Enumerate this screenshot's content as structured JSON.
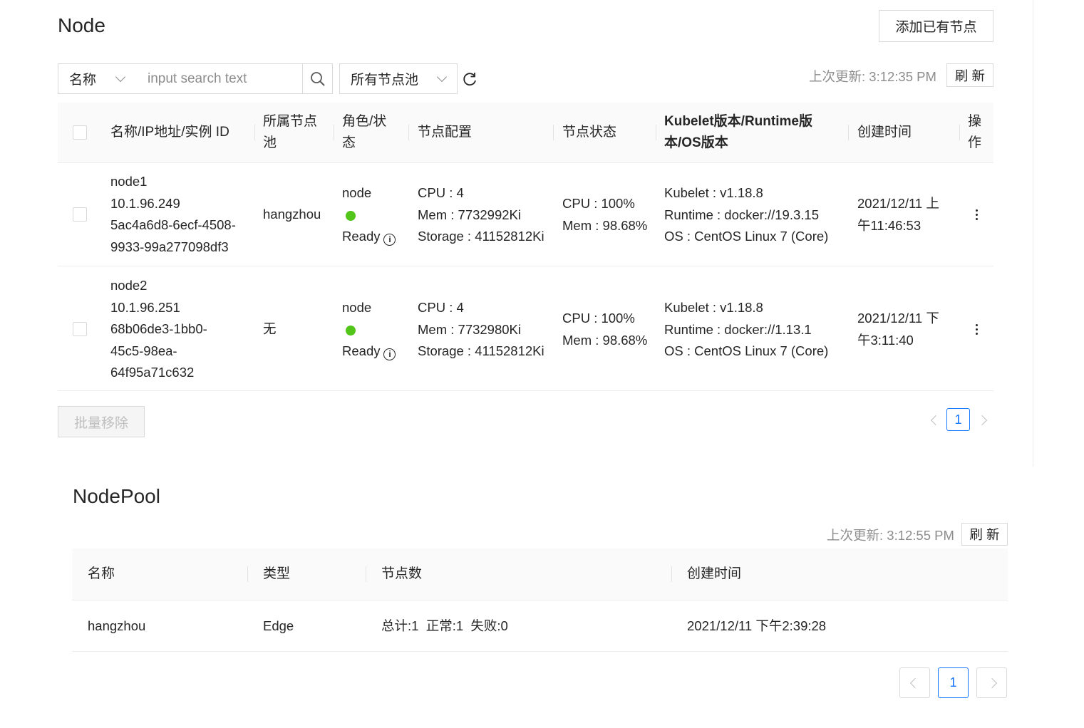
{
  "node": {
    "title": "Node",
    "add_button": "添加已有节点",
    "filter_field": "名称",
    "search_placeholder": "input search text",
    "pool_filter": "所有节点池",
    "last_update": "上次更新: 3:12:35 PM",
    "refresh": "刷 新",
    "headers": {
      "name": "名称/IP地址/实例 ID",
      "pool_l1": "所属节点",
      "pool_l2": "池",
      "role_l1": "角色/状",
      "role_l2": "态",
      "config": "节点配置",
      "status": "节点状态",
      "ver_l1": "Kubelet版本/Runtime版",
      "ver_l2": "本/OS版本",
      "created": "创建时间",
      "op_l1": "操",
      "op_l2": "作"
    },
    "rows": [
      {
        "name": "node1",
        "ip": "10.1.96.249",
        "id_l1": "5ac4a6d8-6ecf-4508-",
        "id_l2": "9933-99a277098df3",
        "pool": "hangzhou",
        "role": "node",
        "state": "Ready",
        "cpu": "CPU : 4",
        "mem": "Mem : 7732992Ki",
        "storage": "Storage : 41152812Ki",
        "cpu_use": "CPU : 100%",
        "mem_use": "Mem : 98.68%",
        "kubelet": "Kubelet : v1.18.8",
        "runtime": "Runtime : docker://19.3.15",
        "os": "OS : CentOS Linux 7 (Core)",
        "created_l1": "2021/12/11 上",
        "created_l2": "午11:46:53"
      },
      {
        "name": "node2",
        "ip": "10.1.96.251",
        "id_l1": "68b06de3-1bb0-",
        "id_l2": "45c5-98ea-",
        "id_l3": "64f95a71c632",
        "pool": "无",
        "role": "node",
        "state": "Ready",
        "cpu": "CPU : 4",
        "mem": "Mem : 7732980Ki",
        "storage": "Storage : 41152812Ki",
        "cpu_use": "CPU : 100%",
        "mem_use": "Mem : 98.68%",
        "kubelet": "Kubelet : v1.18.8",
        "runtime": "Runtime : docker://1.13.1",
        "os": "OS : CentOS Linux 7 (Core)",
        "created_l1": "2021/12/11 下",
        "created_l2": "午3:11:40"
      }
    ],
    "batch_remove": "批量移除",
    "page": "1"
  },
  "nodepool": {
    "title": "NodePool",
    "last_update": "上次更新: 3:12:55 PM",
    "refresh": "刷 新",
    "headers": {
      "name": "名称",
      "type": "类型",
      "count": "节点数",
      "created": "创建时间"
    },
    "rows": [
      {
        "name": "hangzhou",
        "type": "Edge",
        "count": "总计:1  正常:1  失败:0",
        "created": "2021/12/11 下午2:39:28"
      }
    ],
    "page": "1"
  },
  "colors": {
    "accent": "#1677ff",
    "ready": "#52c41a",
    "header_bg": "#fafafa"
  }
}
